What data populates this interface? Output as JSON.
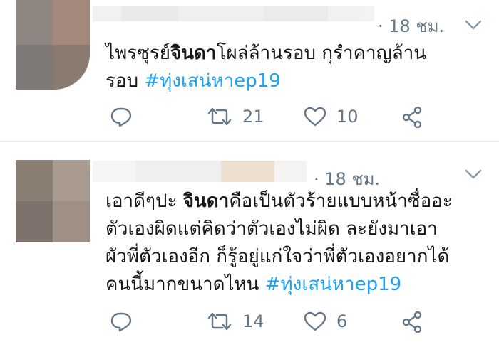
{
  "tweets": [
    {
      "time": "· 18 ชม.",
      "text_parts": [
        "ไพรซุรย์",
        "จินดา",
        "โผล่ล้านรอบ กุรำคาญล้าน",
        "รอบ ",
        "#ทุ่งเสน่หาep19"
      ],
      "retweets": "21",
      "likes": "10"
    },
    {
      "time": "· 18 ชม.",
      "text_parts": [
        "เอาดีๆปะ ",
        "จินดา",
        "คือเป็นตัวร้ายแบบหน้าซื่ออะ",
        "ตัวเองผิดแต่คิดว่าตัวเองไม่ผิด ละยังมาเอา",
        "ผัวพี่ตัวเองอีก ก็รู้อยู่แก่ใจว่าพี่ตัวเองอยากได้",
        "คนนี้มากขนาดไหน  ",
        "#ทุ่งเสน่หาep19"
      ],
      "retweets": "14",
      "likes": "6"
    }
  ],
  "icons": [
    "reply-icon",
    "retweet-icon",
    "like-icon",
    "share-icon",
    "chevron-down-icon"
  ],
  "colors": {
    "hashtag": "#1da1f2",
    "meta": "#657786",
    "text": "#14171a",
    "divider": "#e6ecf0"
  }
}
